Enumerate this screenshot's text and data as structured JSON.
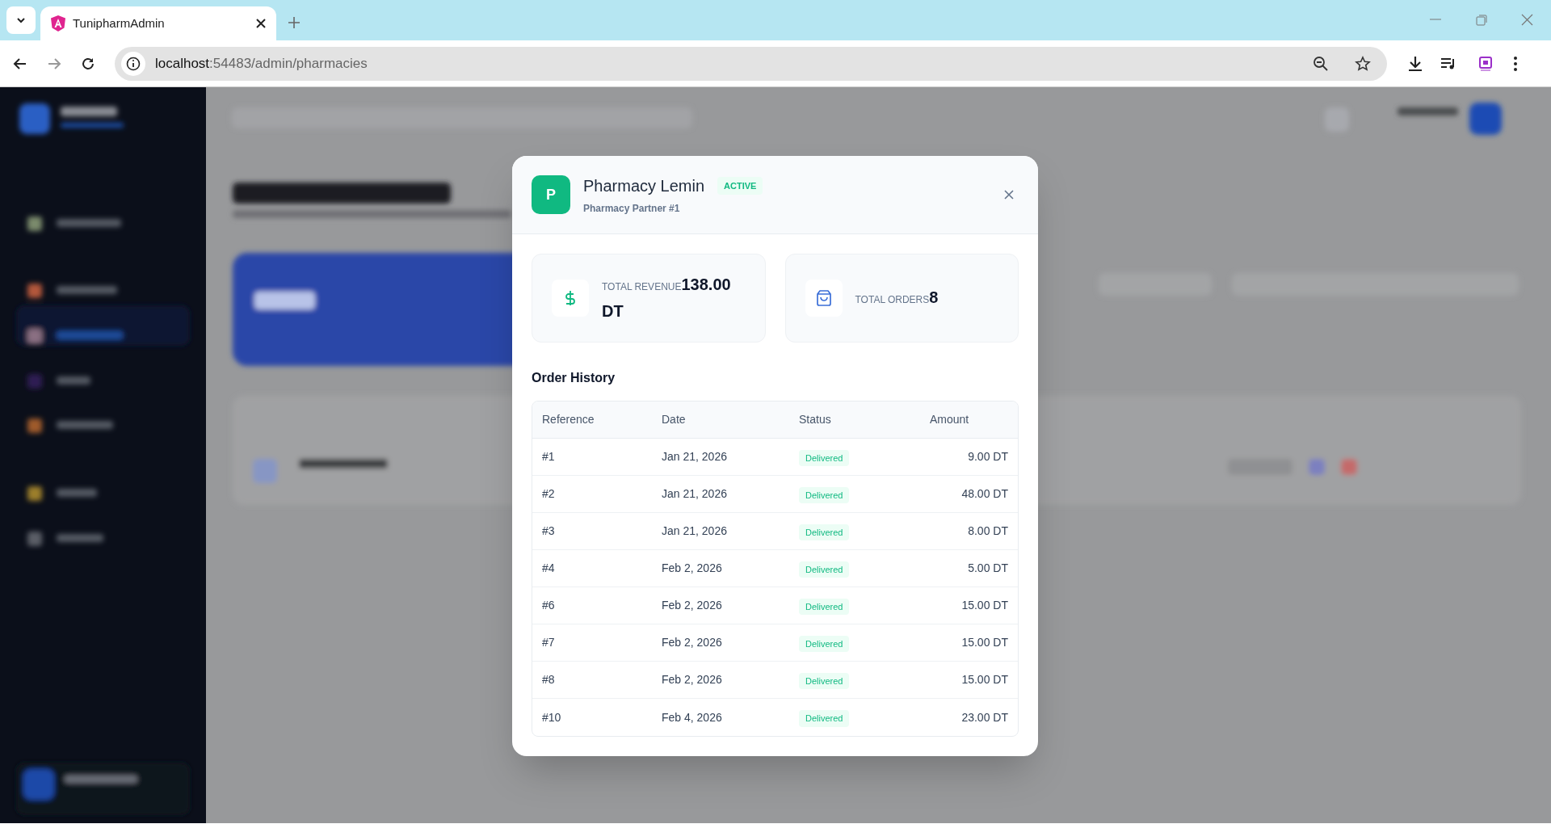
{
  "browser": {
    "tab_title": "TunipharmAdmin",
    "url_host": "localhost",
    "url_path": ":54483/admin/pharmacies",
    "forward_enabled": false
  },
  "modal": {
    "avatar": "P",
    "title": "Pharmacy Lemin",
    "status": "ACTIVE",
    "subtitle": "Pharmacy Partner #1",
    "stats": [
      {
        "kind": "revenue",
        "label": "TOTAL REVENUE",
        "value": "138.00 DT"
      },
      {
        "kind": "orders",
        "label": "TOTAL ORDERS",
        "value": "8"
      }
    ],
    "section_title": "Order History",
    "table": {
      "columns": [
        "Reference",
        "Date",
        "Status",
        "Amount"
      ],
      "rows": [
        {
          "reference": "#1",
          "date": "Jan 21, 2026",
          "status": "Delivered",
          "color": "#10b981",
          "amount": "9.00 DT"
        },
        {
          "reference": "#2",
          "date": "Jan 21, 2026",
          "status": "Delivered",
          "color": "#10b981",
          "amount": "48.00 DT"
        },
        {
          "reference": "#3",
          "date": "Jan 21, 2026",
          "status": "Delivered",
          "color": "#10b981",
          "amount": "8.00 DT"
        },
        {
          "reference": "#4",
          "date": "Feb 2, 2026",
          "status": "Delivered",
          "color": "#10b981",
          "amount": "5.00 DT"
        },
        {
          "reference": "#6",
          "date": "Feb 2, 2026",
          "status": "Delivered",
          "color": "#10b981",
          "amount": "15.00 DT"
        },
        {
          "reference": "#7",
          "date": "Feb 2, 2026",
          "status": "Delivered",
          "color": "#10b981",
          "amount": "15.00 DT"
        },
        {
          "reference": "#8",
          "date": "Feb 2, 2026",
          "status": "Delivered",
          "color": "#10b981",
          "amount": "15.00 DT"
        },
        {
          "reference": "#10",
          "date": "Feb 4, 2026",
          "status": "Delivered",
          "color": "#10b981",
          "amount": "23.00 DT"
        }
      ]
    }
  }
}
